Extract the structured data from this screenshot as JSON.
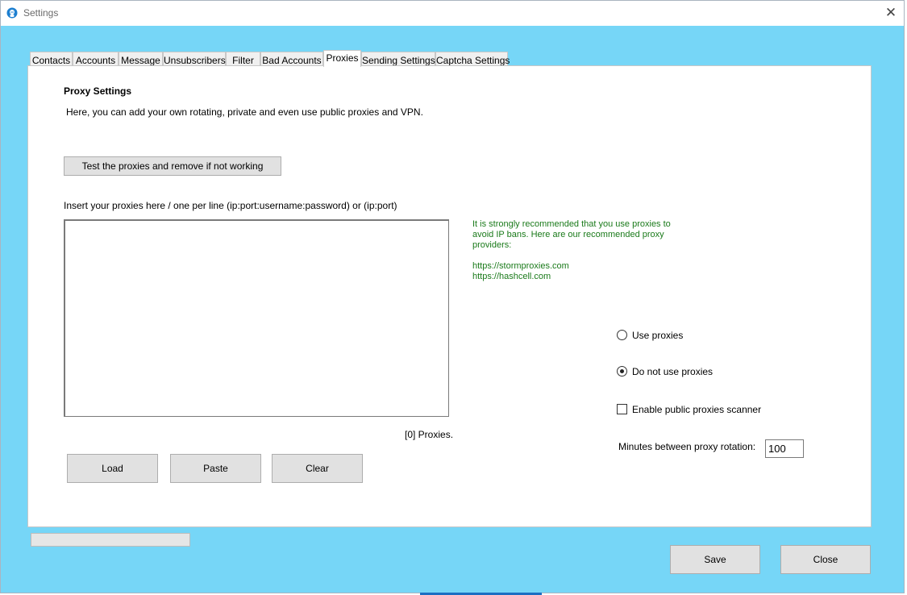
{
  "window": {
    "title": "Settings",
    "close_glyph": "✕",
    "icon": "app-icon",
    "background_color": "#76d6f7"
  },
  "tabs": [
    {
      "label": "Contacts",
      "active": false
    },
    {
      "label": "Accounts",
      "active": false
    },
    {
      "label": "Message",
      "active": false
    },
    {
      "label": "Unsubscribers",
      "active": false
    },
    {
      "label": "Filter",
      "active": false
    },
    {
      "label": "Bad Accounts",
      "active": false
    },
    {
      "label": "Proxies",
      "active": true
    },
    {
      "label": "Sending Settings",
      "active": false
    },
    {
      "label": "Captcha Settings",
      "active": false
    }
  ],
  "proxies": {
    "heading": "Proxy Settings",
    "description": "Here, you can add your own rotating, private and even use public proxies and VPN.",
    "test_button": "Test the proxies and remove if not working",
    "insert_label": "Insert your proxies here / one per line (ip:port:username:password) or  (ip:port)",
    "textarea_value": "",
    "count_text": "[0] Proxies.",
    "load_button": "Load",
    "paste_button": "Paste",
    "clear_button": "Clear",
    "recommendation": "It is strongly recommended that you use proxies to avoid IP bans. Here are our recommended proxy providers:",
    "links": [
      "https://stormproxies.com",
      "https://hashcell.com"
    ],
    "recommendation_color": "#1a7a1a",
    "use_proxies_label": "Use proxies",
    "use_proxies_selected": false,
    "no_proxies_label": "Do not use proxies",
    "no_proxies_selected": true,
    "scanner_label": "Enable public proxies scanner",
    "scanner_checked": false,
    "rotation_label": "Minutes between proxy rotation:",
    "rotation_value": "100"
  },
  "footer": {
    "progress": 0,
    "save_button": "Save",
    "close_button": "Close"
  }
}
